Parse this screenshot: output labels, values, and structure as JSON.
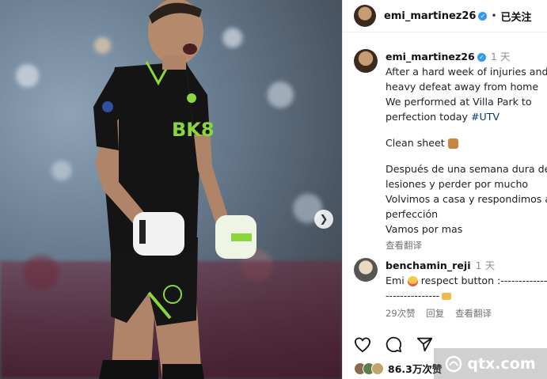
{
  "header": {
    "username": "emi_martinez26",
    "separator": "•",
    "follow_label": "已关注"
  },
  "caption": {
    "username": "emi_martinez26",
    "time": "1 天",
    "lines_en": [
      "After a hard week of injuries and",
      "heavy defeat away from home",
      "We performed at Villa Park to",
      "perfection today "
    ],
    "hashtag": "#UTV",
    "clean_sheet": "Clean sheet",
    "lines_es": [
      "Después de una semana dura de",
      "lesiones y perder por mucho",
      "Volvimos a casa y respondimos a",
      "perfección",
      "Vamos por mas"
    ],
    "translate": "查看翻译"
  },
  "comment": {
    "username": "benchamin_reji",
    "time": "1 天",
    "text_a": "Emi",
    "text_b": "respect button :---------------",
    "text_c": "---------------",
    "likes": "29次赞",
    "reply": "回复",
    "translate": "查看翻译"
  },
  "post": {
    "likes": "86.3万次赞"
  },
  "watermark": {
    "text": "qtx.com"
  },
  "photo": {
    "sponsor": "BK8"
  },
  "icons": [
    "verified-icon",
    "heart-icon",
    "comment-icon",
    "share-icon",
    "next-arrow-icon"
  ],
  "colors": {
    "verified": "#3897f0",
    "hashtag": "#00376b",
    "shirt": "#141414",
    "accent": "#8bd63b"
  }
}
